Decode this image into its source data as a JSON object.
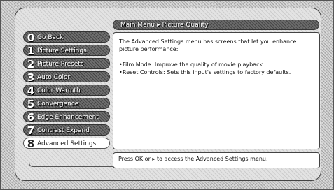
{
  "breadcrumb": {
    "root": "Main Menu",
    "separator": "▸",
    "current": "Picture Quality"
  },
  "menu": {
    "items": [
      {
        "num": "0",
        "label": "Go Back"
      },
      {
        "num": "1",
        "label": "Picture Settings"
      },
      {
        "num": "2",
        "label": "Picture Presets"
      },
      {
        "num": "3",
        "label": "Auto Color"
      },
      {
        "num": "4",
        "label": "Color Warmth"
      },
      {
        "num": "5",
        "label": "Convergence"
      },
      {
        "num": "6",
        "label": "Edge Enhancement"
      },
      {
        "num": "7",
        "label": "Contrast Expand"
      },
      {
        "num": "8",
        "label": "Advanced Settings"
      }
    ],
    "selected_index": 8
  },
  "content": {
    "intro": "The Advanced Settings menu has screens that let you enhance picture performance:",
    "bullet_glyph": "•",
    "bullets": [
      "Film Mode: Improve the quality of movie playback.",
      "Reset Controls: Sets this input's settings to factory defaults."
    ]
  },
  "hint": {
    "text": "Press OK or ▸ to access the Advanced Settings menu."
  }
}
